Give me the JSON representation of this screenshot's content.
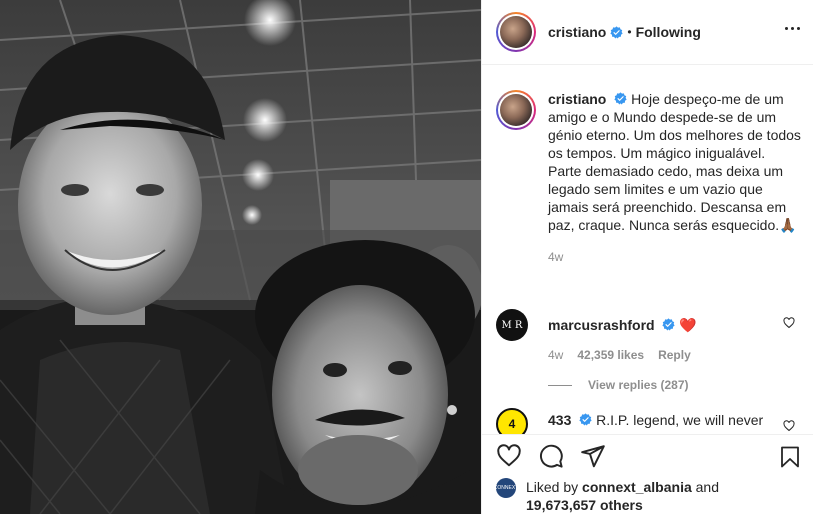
{
  "post": {
    "username": "cristiano",
    "separator": "•",
    "follow_status": "Following"
  },
  "caption": {
    "username": "cristiano",
    "text": "Hoje despeço-me de um amigo e o Mundo despede-se de um génio eterno. Um dos melhores de todos os tempos. Um mágico inigualável. Parte demasiado cedo, mas deixa um legado sem limites e um vazio que jamais será preenchido. Descansa em paz, craque. Nunca serás esquecido.",
    "emoji": "🙏🏾",
    "time": "4w"
  },
  "comments": [
    {
      "username": "marcusrashford",
      "text": "❤️",
      "time": "4w",
      "likes": "42,359 likes",
      "reply_label": "Reply",
      "view_replies": "View replies (287)",
      "avatar_text": "M R"
    },
    {
      "username": "433",
      "text": "R.I.P. legend, we will never",
      "avatar_text": "4"
    }
  ],
  "likes": {
    "prefix": "Liked by",
    "user": "connext_albania",
    "conj": "and",
    "count": "19,673,657 others",
    "avatar_text": "CONNEXT"
  },
  "icons": {
    "like": "heart-icon",
    "comment": "comment-icon",
    "share": "send-icon",
    "save": "bookmark-icon",
    "more": "more-options-icon",
    "verified": "verified-badge-icon"
  },
  "colors": {
    "verified_blue": "#3897f0",
    "muted_text": "#8e8e8e",
    "heart_red": "#ed4956"
  }
}
